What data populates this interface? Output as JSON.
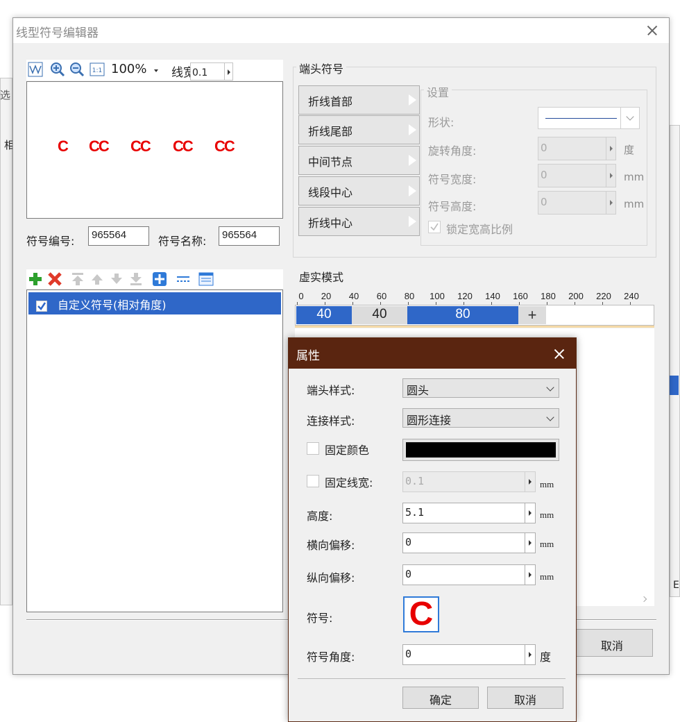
{
  "background_fragments": {
    "left_char_1": "选",
    "left_char_2": "相",
    "right_btn": "E"
  },
  "main_dialog": {
    "title": "线型符号编辑器",
    "toolbar": {
      "zoom": "100%",
      "line_width_label": "线宽",
      "line_width_value": "0.1"
    },
    "preview_glyphs": [
      "C",
      "CC",
      "CC",
      "CC",
      "CC"
    ],
    "symbol_id_label": "符号编号:",
    "symbol_id_value": "965564",
    "symbol_name_label": "符号名称:",
    "symbol_name_value": "965564",
    "symbol_list": [
      {
        "label": "自定义符号(相对角度)",
        "checked": true
      }
    ],
    "endpoint_group_title": "端头符号",
    "endpoint_buttons": [
      "折线首部",
      "折线尾部",
      "中间节点",
      "线段中心",
      "折线中心"
    ],
    "settings": {
      "title": "设置",
      "shape_label": "形状:",
      "rotation_label": "旋转角度:",
      "rotation_value": "0",
      "rotation_unit": "度",
      "width_label": "符号宽度:",
      "width_value": "0",
      "width_unit": "mm",
      "height_label": "符号高度:",
      "height_value": "0",
      "height_unit": "mm",
      "lock_label": "锁定宽高比例"
    },
    "dash_title": "虚实模式",
    "ruler_ticks": [
      "0",
      "20",
      "40",
      "60",
      "80",
      "100",
      "120",
      "140",
      "160",
      "180",
      "200",
      "220",
      "240"
    ],
    "dash_segments": [
      {
        "label": "40",
        "length": 40,
        "type": "solid"
      },
      {
        "label": "40",
        "length": 40,
        "type": "gap"
      },
      {
        "label": "80",
        "length": 80,
        "type": "solid"
      }
    ],
    "add_segment": "+",
    "cancel_label": "取消"
  },
  "property_dialog": {
    "title": "属性",
    "cap_style_label": "端头样式:",
    "cap_style_value": "圆头",
    "join_style_label": "连接样式:",
    "join_style_value": "圆形连接",
    "fixed_color_label": "固定颜色",
    "fixed_color_value": "#000000",
    "fixed_width_label": "固定线宽:",
    "fixed_width_value": "0.1",
    "fixed_width_unit": "mm",
    "height_label": "高度:",
    "height_value": "5.1",
    "height_unit": "mm",
    "h_offset_label": "横向偏移:",
    "h_offset_value": "0",
    "h_offset_unit": "mm",
    "v_offset_label": "纵向偏移:",
    "v_offset_value": "0",
    "v_offset_unit": "mm",
    "symbol_label": "符号:",
    "symbol_glyph": "C",
    "angle_label": "符号角度:",
    "angle_value": "0",
    "angle_unit": "度",
    "ok_label": "确定",
    "cancel_label": "取消"
  },
  "colors": {
    "accent_blue": "#2f67c8",
    "symbol_red": "#e80000",
    "prop_titlebar": "#5a2510"
  }
}
